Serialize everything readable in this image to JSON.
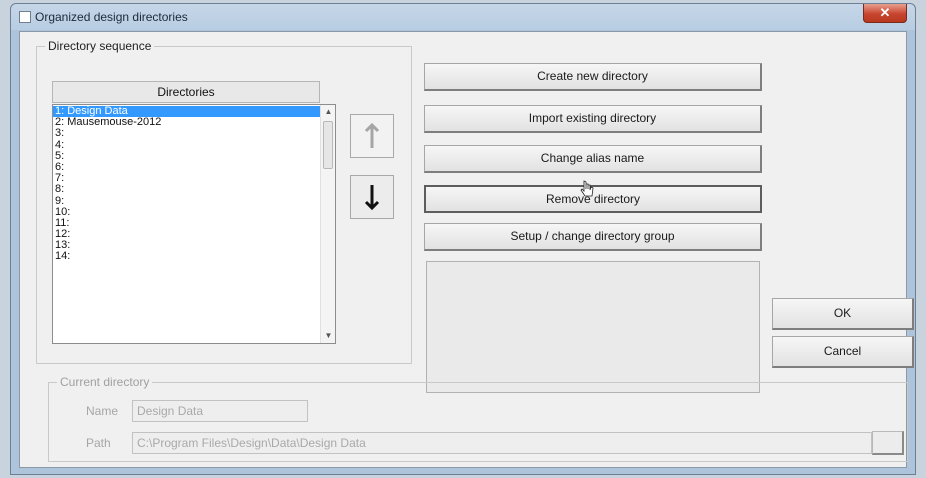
{
  "window": {
    "title": "Organized design directories",
    "close_glyph": "✕"
  },
  "directory_sequence": {
    "label": "Directory sequence",
    "header": "Directories",
    "items": [
      "1: Design Data",
      "2: Mausemouse-2012",
      "3:",
      "4:",
      "5:",
      "6:",
      "7:",
      "8:",
      "9:",
      "10:",
      "11:",
      "12:",
      "13:",
      "14:"
    ],
    "selected_index": 0
  },
  "move_buttons": {
    "up_icon": "arrow-up-icon",
    "down_icon": "arrow-down-icon"
  },
  "actions": {
    "create": "Create new directory",
    "import": "Import existing directory",
    "change_alias": "Change alias name",
    "remove": "Remove directory",
    "setup_group": "Setup / change directory group"
  },
  "dialog": {
    "ok": "OK",
    "cancel": "Cancel"
  },
  "current_directory": {
    "label": "Current directory",
    "name_label": "Name",
    "name_value": "Design Data",
    "path_label": "Path",
    "path_value": "C:\\Program Files\\Design\\Data\\Design Data"
  },
  "colors": {
    "selection": "#3399ff",
    "close_button": "#c7452e"
  }
}
